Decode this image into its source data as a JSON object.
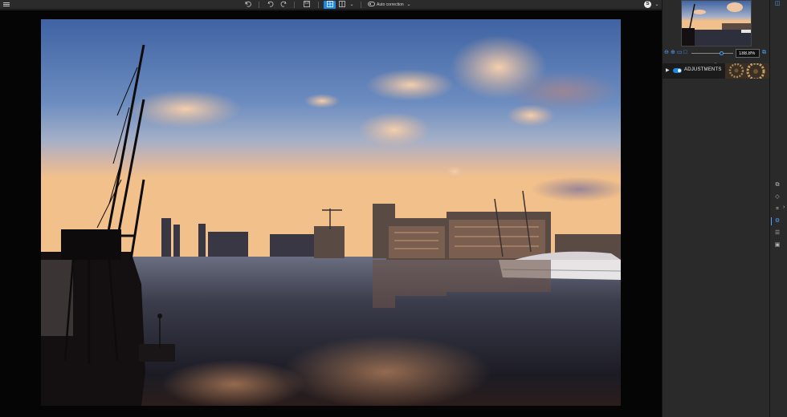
{
  "toolbar": {
    "menu_icon": "hamburger-icon",
    "undo_history_icon": "undo-history-icon",
    "undo_icon": "undo-icon",
    "redo_icon": "redo-icon",
    "save_icon": "save-icon",
    "single_view_icon": "single-view-icon",
    "compare_view_icon": "compare-view-icon",
    "auto_correction_label": "Auto correction",
    "auto_correction_on": false,
    "account_initial": "S"
  },
  "navigator": {
    "zoom_value": "188.8%",
    "zoom_slider_fraction": 0.72
  },
  "adjustments": {
    "label": "ADJUSTMENTS",
    "enabled": true
  },
  "rail": {
    "icons": [
      "layers-icon",
      "eraser-icon",
      "crop-icon",
      "adjust-icon",
      "list-icon",
      "image-icon"
    ],
    "active_index": 3
  },
  "colors": {
    "accent": "#1e88e5",
    "panel": "#2a2a2a",
    "toolbar": "#2b2b2b"
  }
}
